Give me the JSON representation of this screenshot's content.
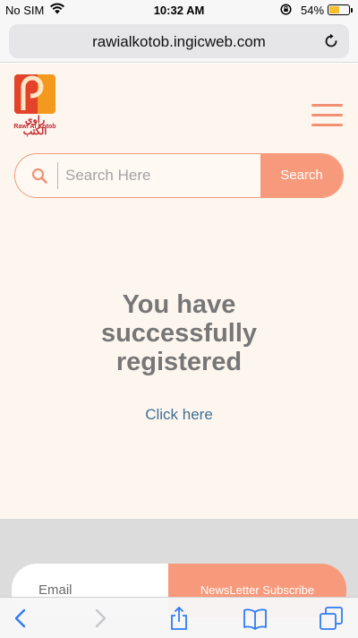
{
  "status_bar": {
    "carrier": "No SIM",
    "time": "10:32 AM",
    "battery_percent": "54%",
    "battery_level": 0.54,
    "icons": [
      "wifi-icon",
      "rotation-lock-icon",
      "battery-icon"
    ]
  },
  "browser": {
    "url": "rawialkotob.ingicweb.com",
    "reload_icon": "reload-icon",
    "toolbar_icons": [
      "back-icon",
      "forward-icon",
      "share-icon",
      "bookmarks-icon",
      "tabs-icon"
    ]
  },
  "header": {
    "logo_arabic": "راوي الكتب",
    "logo_english": "Rawi Al Kotob",
    "menu_icon": "hamburger-menu-icon"
  },
  "search": {
    "placeholder": "Search Here",
    "button_label": "Search",
    "icon": "search-icon"
  },
  "main": {
    "message_line1": "You have",
    "message_line2": "successfully",
    "message_line3": "registered",
    "link_label": "Click here"
  },
  "footer": {
    "email_placeholder": "Email",
    "subscribe_label": "NewsLetter Subscribe"
  },
  "colors": {
    "accent": "#f79a7c",
    "page_background": "#fdf6ef",
    "message_text": "#777777",
    "link": "#3f6f95",
    "logo_red": "#c2272d",
    "logo_orange": "#f39a1e"
  }
}
